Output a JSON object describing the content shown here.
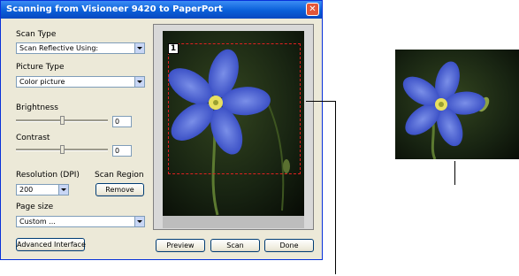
{
  "window": {
    "title": "Scanning from Visioneer 9420 to PaperPort"
  },
  "scan_type": {
    "label": "Scan Type",
    "value": "Scan Reflective Using:"
  },
  "picture_type": {
    "label": "Picture Type",
    "value": "Color picture"
  },
  "brightness": {
    "label": "Brightness",
    "value": "0",
    "level": 0.5
  },
  "contrast": {
    "label": "Contrast",
    "value": "0",
    "level": 0.5
  },
  "resolution": {
    "label": "Resolution (DPI)",
    "value": "200"
  },
  "scan_region": {
    "label": "Scan Region",
    "remove_label": "Remove",
    "number": "1"
  },
  "page_size": {
    "label": "Page size",
    "value": "Custom ..."
  },
  "buttons": {
    "advanced": "Advanced Interface",
    "preview": "Preview",
    "scan": "Scan",
    "done": "Done"
  },
  "colors": {
    "title_bar": "#0a5fd8",
    "dialog_bg": "#ece9d8",
    "region_border": "#e02020"
  }
}
